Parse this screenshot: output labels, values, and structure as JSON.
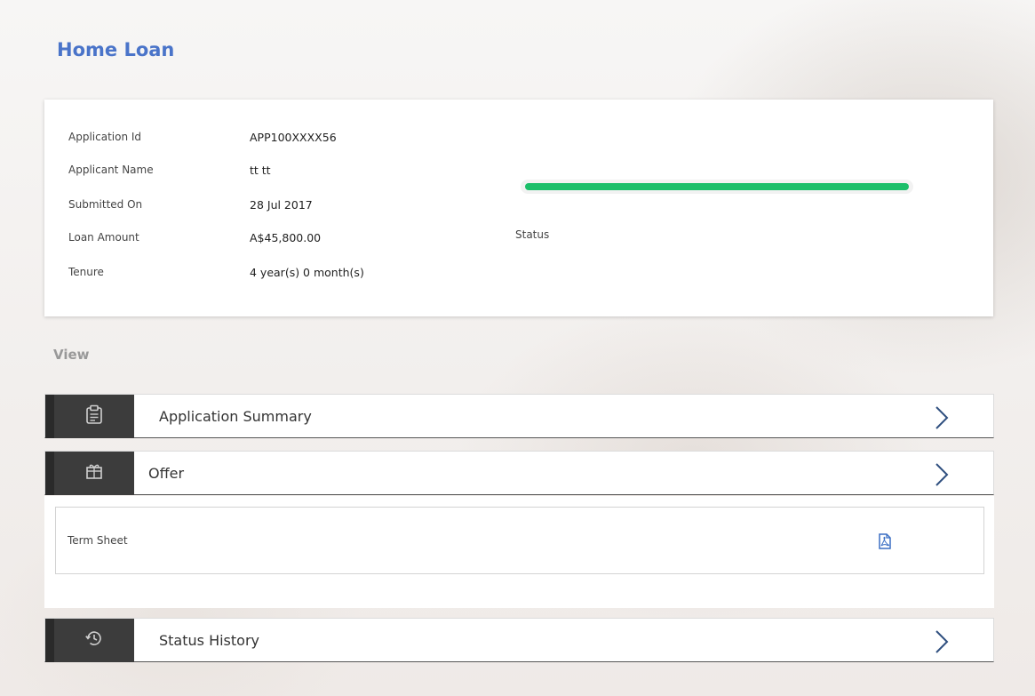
{
  "page": {
    "title": "Home Loan"
  },
  "application": {
    "fields": [
      {
        "label": "Application Id",
        "value": "APP100XXXX56"
      },
      {
        "label": "Applicant Name",
        "value": "tt tt"
      },
      {
        "label": "Submitted On",
        "value": "28 Jul 2017"
      },
      {
        "label": "Loan Amount",
        "value": "A$45,800.00"
      },
      {
        "label": "Tenure",
        "value": "4 year(s) 0 month(s)"
      }
    ],
    "status_label": "Status",
    "status_progress": 1.0,
    "status_color": "#1cbf6a"
  },
  "view": {
    "heading": "View",
    "sections": [
      {
        "label": "Application Summary",
        "icon": "clipboard-icon"
      },
      {
        "label": "Offer",
        "icon": "gift-icon"
      },
      {
        "label": "Status History",
        "icon": "history-icon"
      }
    ],
    "offer": {
      "term_sheet_label": "Term Sheet",
      "doc_icon": "pdf-document-icon"
    }
  },
  "colors": {
    "accent": "#4a74c9",
    "icon_box": "#3c3c3c",
    "chevron": "#2f4f7f"
  }
}
